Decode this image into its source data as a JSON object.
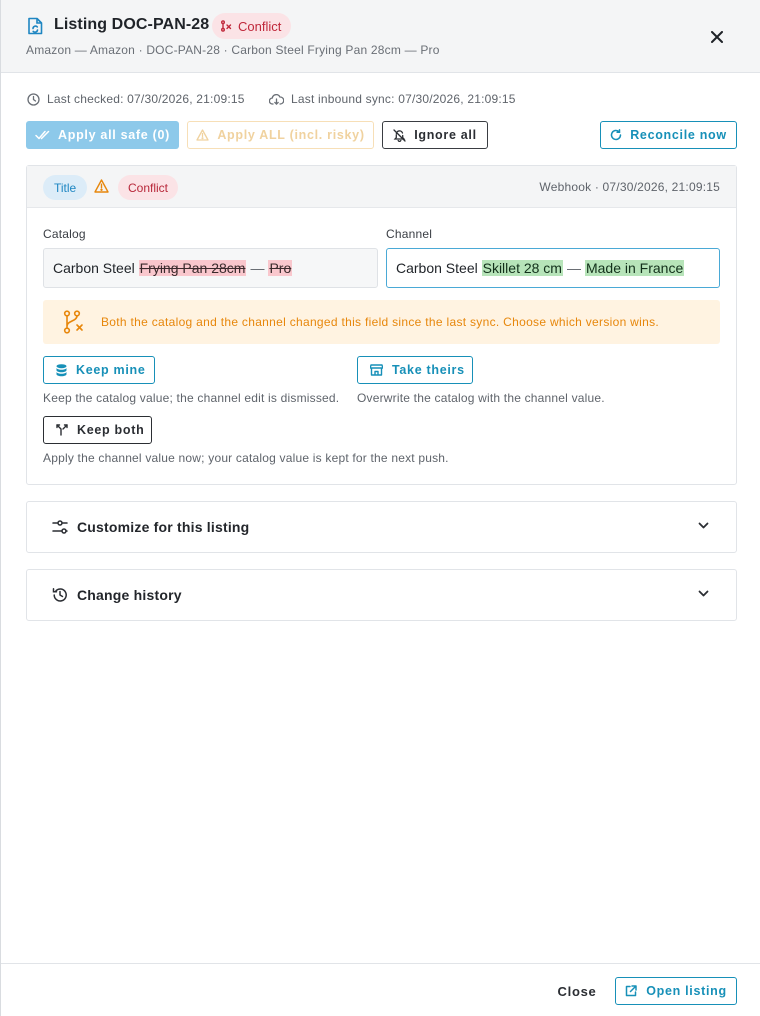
{
  "header": {
    "title": "Listing DOC-PAN-28",
    "status_badge": "Conflict",
    "subtitle": "Amazon — Amazon · DOC-PAN-28 · Carbon Steel Frying Pan 28cm — Pro",
    "close_icon": "close-icon"
  },
  "meta": {
    "last_checked": "Last checked: 07/30/2026, 21:09:15",
    "last_inbound": "Last inbound sync: 07/30/2026, 21:09:15"
  },
  "actions": {
    "apply_safe": "Apply all safe (0)",
    "apply_all": "Apply ALL (incl. risky)",
    "ignore_all": "Ignore all",
    "reconcile": "Reconcile now"
  },
  "field": {
    "name": "Title",
    "status": "Conflict",
    "source": "Webhook · 07/30/2026, 21:09:15",
    "catalog_label": "Catalog",
    "channel_label": "Channel",
    "catalog_value": {
      "common": "Carbon Steel",
      "removed_1": "Frying Pan 28cm",
      "sep": "—",
      "removed_2": "Pro"
    },
    "channel_value": {
      "common": "Carbon Steel",
      "added_1": "Skillet 28 cm",
      "sep": "—",
      "added_2": "Made in France"
    },
    "notice": "Both the catalog and the channel changed this field since the last sync. Choose which version wins.",
    "keep_mine": "Keep mine",
    "keep_mine_desc": "Keep the catalog value; the channel edit is dismissed.",
    "take_theirs": "Take theirs",
    "take_theirs_desc": "Overwrite the catalog with the channel value.",
    "keep_both": "Keep both",
    "keep_both_desc": "Apply the channel value now; your catalog value is kept for the next push."
  },
  "sections": {
    "customize": "Customize for this listing",
    "history": "Change history"
  },
  "footer": {
    "close": "Close",
    "open_listing": "Open listing"
  },
  "colors": {
    "accent": "#1790b8",
    "conflict": "#c0283b",
    "warning": "#e7870c"
  }
}
